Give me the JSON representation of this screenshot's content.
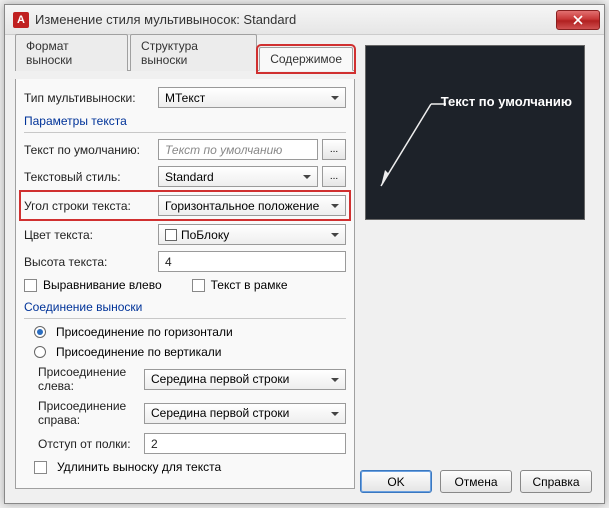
{
  "window": {
    "app_icon_letter": "А",
    "title": "Изменение стиля мультивыносок: Standard"
  },
  "tabs": [
    {
      "label": "Формат выноски"
    },
    {
      "label": "Структура выноски"
    },
    {
      "label": "Содержимое"
    }
  ],
  "type_row": {
    "label": "Тип мультивыноски:",
    "value": "МТекст"
  },
  "params_group": "Параметры текста",
  "default_text": {
    "label": "Текст по умолчанию:",
    "placeholder": "Текст по умолчанию"
  },
  "text_style": {
    "label": "Текстовый стиль:",
    "value": "Standard"
  },
  "text_angle": {
    "label": "Угол строки текста:",
    "value": "Горизонтальное положение"
  },
  "text_color": {
    "label": "Цвет текста:",
    "value": "ПоБлоку"
  },
  "text_height": {
    "label": "Высота текста:",
    "value": "4"
  },
  "align_left": "Выравнивание влево",
  "frame_text": "Текст в рамке",
  "attach_group": "Соединение выноски",
  "attach_horiz": "Присоединение по горизонтали",
  "attach_vert": "Присоединение по вертикали",
  "attach_left": {
    "label": "Присоединение слева:",
    "value": "Середина первой строки"
  },
  "attach_right": {
    "label": "Присоединение справа:",
    "value": "Середина первой строки"
  },
  "landing_gap": {
    "label": "Отступ от полки:",
    "value": "2"
  },
  "extend_leader": "Удлинить выноску для текста",
  "preview_text": "Текст по умолчанию",
  "buttons": {
    "ok": "OK",
    "cancel": "Отмена",
    "help": "Справка"
  }
}
